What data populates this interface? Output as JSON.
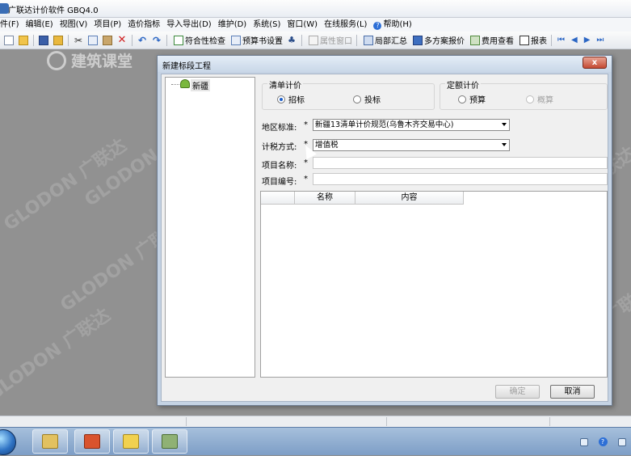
{
  "window": {
    "title": "广联达计价软件 GBQ4.0"
  },
  "menu": {
    "items": [
      "件(F)",
      "编辑(E)",
      "视图(V)",
      "项目(P)",
      "造价指标",
      "导入导出(D)",
      "维护(D)",
      "系统(S)",
      "窗口(W)",
      "在线服务(L)",
      "帮助(H)"
    ]
  },
  "toolbar": {
    "compliance_check": "符合性检查",
    "budget_settings": "预算书设置",
    "property_window": "属性窗口",
    "partial_summary": "局部汇总",
    "multi_plan_quote": "多方案报价",
    "fee_view": "费用查看",
    "report": "报表"
  },
  "background": {
    "logo_text": "建筑课堂",
    "watermark": "GLODON 广联达"
  },
  "dialog": {
    "title": "新建标段工程",
    "close_label": "x",
    "tree": {
      "root": "新疆"
    },
    "bill_pricing": {
      "title": "清单计价",
      "options": [
        "招标",
        "投标"
      ],
      "selected": "招标"
    },
    "quota_pricing": {
      "title": "定额计价",
      "options": [
        "预算",
        "概算"
      ],
      "selected": "none"
    },
    "fields": {
      "region_label": "地区标准:",
      "region_value": "新疆13清单计价规范(乌鲁木齐交易中心)",
      "tax_label": "计税方式:",
      "tax_value": "增值税",
      "project_name_label": "项目名称:",
      "project_code_label": "项目编号:",
      "required_mark": "*"
    },
    "grid": {
      "columns": [
        "名称",
        "内容"
      ]
    },
    "buttons": {
      "ok": "确定",
      "cancel": "取消"
    }
  }
}
